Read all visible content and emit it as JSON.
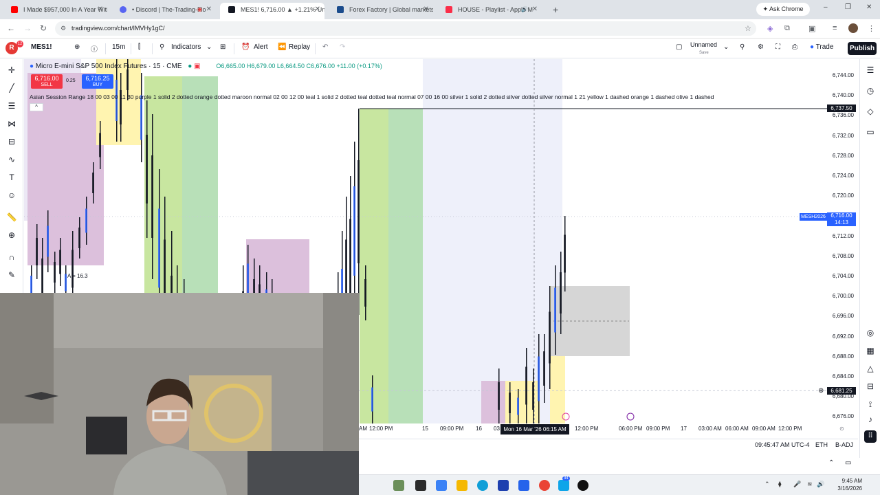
{
  "browser": {
    "tabs": [
      {
        "title": "I Made $957,000 In A Year With",
        "favicon_color": "#ff0000"
      },
      {
        "title": "• Discord | The-Trading-Flo",
        "favicon_color": "#5865f2"
      },
      {
        "title": "MES1! 6,716.00 ▲ +1.21% Unn",
        "favicon_color": "#131722"
      },
      {
        "title": "Forex Factory | Global markets",
        "favicon_color": "#1a4b8c"
      },
      {
        "title": "HOUSE - Playlist - Apple M",
        "favicon_color": "#fa2d48"
      }
    ],
    "active_tab": 2,
    "new_tab": "+",
    "ask_chrome": "Ask Chrome",
    "url": "tradingview.com/chart/IMVHy1gC/",
    "window_controls": {
      "minimize": "–",
      "restore": "❐",
      "close": "✕"
    }
  },
  "toolbar": {
    "logo_letter": "R",
    "logo_badge": "12",
    "symbol": "MES1!",
    "interval": "15m",
    "indicators": "Indicators",
    "alert": "Alert",
    "replay": "Replay",
    "layout_name": "Unnamed",
    "layout_sub": "Save",
    "trade": "Trade",
    "publish": "Publish"
  },
  "chart": {
    "title": "Micro E-mini S&P 500 Index Futures · 15 · CME",
    "ohlc": "O6,665.00 H6,679.00 L6,664.50 C6,676.00 +11.00 (+0.17%)",
    "sell_price": "6,716.00",
    "sell_label": "SELL",
    "spread": "0.25",
    "buy_price": "6,716.25",
    "buy_label": "BUY",
    "indicator_line": "Asian Session Range 18 00 03 00 11 30 purple 1 solid 2 dotted orange dotted maroon normal 02 00 12 00 teal 1 solid 2 dotted teal dotted teal normal 07 00 16 00 silver 1 solid 2 dotted silver dotted silver normal 1 21 yellow 1 dashed orange 1 dashed olive 1 dashed",
    "range_label": "A = 16.3",
    "collapse": "^",
    "colors": {
      "up": "#089981",
      "down": "#f23645",
      "asia": "#dcc0dc",
      "london": "#c8e6a0",
      "ny": "#b8e0b8",
      "pre": "#fff4b0"
    }
  },
  "price_axis": {
    "ticks": [
      "6,744.00",
      "6,740.00",
      "6,736.00",
      "6,732.00",
      "6,728.00",
      "6,724.00",
      "6,720.00",
      "6,716.00",
      "6,712.00",
      "6,708.00",
      "6,704.00",
      "6,700.00",
      "6,696.00",
      "6,692.00",
      "6,688.00",
      "6,684.00",
      "6,680.00",
      "6,676.00"
    ],
    "high_label": "6,737.50",
    "last_price": "6,716.00",
    "countdown": "14:13",
    "symbol_tag": "MESH2026",
    "cursor_price": "6,681.25"
  },
  "time_axis": {
    "ticks": [
      "AM",
      "12:00 PM",
      "15",
      "09:00 PM",
      "16",
      "03",
      "12:00 PM",
      "06:00 PM",
      "09:00 PM",
      "17",
      "03:00 AM",
      "06:00 AM",
      "09:00 AM",
      "12:00 PM"
    ],
    "cursor_label": "Mon 16 Mar '26   06:15 AM"
  },
  "status": {
    "clock": "09:45:47 AM UTC-4",
    "eth": "ETH",
    "badj": "B-ADJ"
  },
  "taskbar": {
    "time": "9:45 AM",
    "date": "3/16/2026",
    "badge": "34"
  }
}
